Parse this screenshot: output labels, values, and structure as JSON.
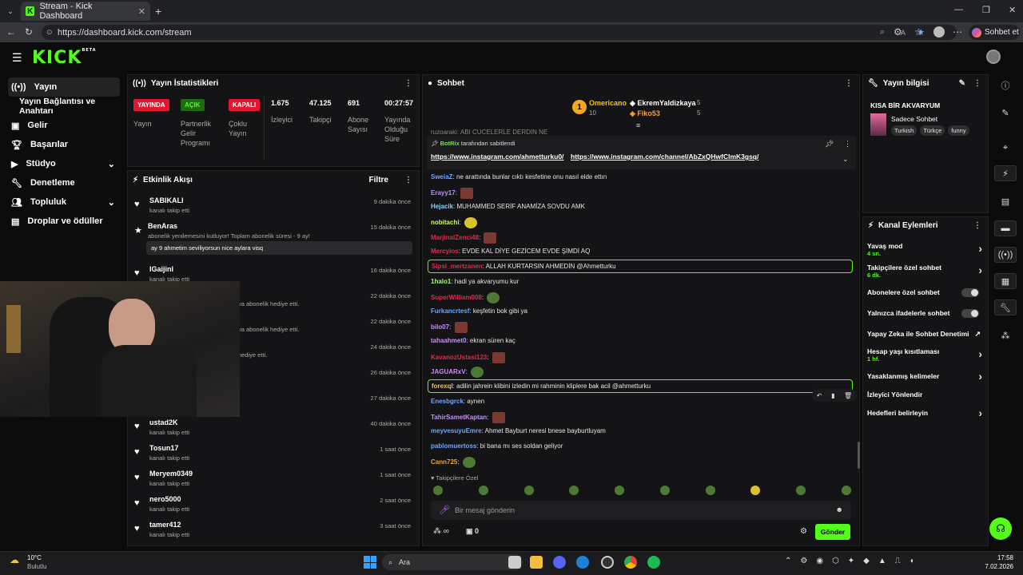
{
  "browser": {
    "tab_title": "Stream - Kick Dashboard",
    "url": "https://dashboard.kick.com/stream",
    "chat_button": "Sohbet et"
  },
  "logo": {
    "text": "KICK",
    "tag": "BETA"
  },
  "nav": {
    "items": [
      {
        "label": "Yayın",
        "icon": "broadcast-icon"
      },
      {
        "label": "Yayın Bağlantısı ve Anahtarı",
        "icon": ""
      },
      {
        "label": "Gelir",
        "icon": "dollar-icon"
      },
      {
        "label": "Başarılar",
        "icon": "trophy-icon"
      },
      {
        "label": "Stüdyo",
        "icon": "video-icon"
      },
      {
        "label": "Denetleme",
        "icon": "wrench-icon"
      },
      {
        "label": "Topluluk",
        "icon": "people-icon"
      },
      {
        "label": "Droplar ve ödüller",
        "icon": "gift-icon"
      }
    ]
  },
  "stats": {
    "title": "Yayın İstatistikleri",
    "badge_live": "YAYINDA",
    "badge_on": "AÇIK",
    "badge_off": "KAPALI",
    "label_live": "Yayın",
    "label_partner": "Partnerlik Gelir Programı",
    "label_multi": "Çoklu Yayın",
    "viewers": "1.675",
    "viewers_label": "İzleyici",
    "followers": "47.125",
    "followers_label": "Takipçi",
    "subs": "691",
    "subs_label": "Abone Sayısı",
    "uptime": "00:27:57",
    "uptime_label": "Yayında Olduğu Süre"
  },
  "activity": {
    "title": "Etkinlik Akışı",
    "filter": "Filtre",
    "items": [
      {
        "name": "SABIKALI",
        "sub": "kanalı takip etti",
        "time": "9 dakika önce"
      },
      {
        "name": "BenAras",
        "sub": "abonelik yenilemesini kutluyor! Toplam abonelik süresi - 9 ay!",
        "time": "15 dakika önce",
        "msg": "ay 9 ahmetim seviliyorsun nice aylara visq"
      },
      {
        "name": "IGaijinI",
        "sub": "kanalı takip etti",
        "time": "16 dakika önce"
      },
      {
        "name": "",
        "sub": "ya abonelik hediye etti.",
        "time": "22 dakika önce"
      },
      {
        "name": "",
        "sub": "ya abonelik hediye etti.",
        "time": "22 dakika önce"
      },
      {
        "name": "",
        "sub": "hediye etti.",
        "time": "24 dakika önce"
      },
      {
        "name": "",
        "sub": "",
        "time": "26 dakika önce"
      },
      {
        "name": "",
        "sub": "",
        "time": "27 dakika önce"
      },
      {
        "name": "ustad2K",
        "sub": "kanalı takip etti",
        "time": "40 dakika önce"
      },
      {
        "name": "Tosun17",
        "sub": "kanalı takip etti",
        "time": "1 saat önce"
      },
      {
        "name": "Meryem0349",
        "sub": "kanalı takip etti",
        "time": "1 saat önce"
      },
      {
        "name": "nero5000",
        "sub": "kanalı takip etti",
        "time": "2 saat önce"
      },
      {
        "name": "tamer412",
        "sub": "kanalı takip etti",
        "time": "3 saat önce"
      }
    ]
  },
  "chat": {
    "title": "Sohbet",
    "leader1": {
      "rank": "1",
      "name": "Omericano",
      "count": "10"
    },
    "leader2": {
      "name": "EkremYaldizkaya",
      "count": "5"
    },
    "leader3": {
      "name": "Fiko53",
      "count": "5"
    },
    "pinned_by": "BotRix",
    "pinned_suffix": "tarafından sabitlendi",
    "pinned_link1": "https://www.instagram.com/ahmetturku0/",
    "pinned_link2": "https://www.instagram.com/channel/AbZxQHwfCImK3gsq/",
    "cut_line": "ruzgaraki: ABI CUCELERLE DERDIN NE",
    "messages": [
      {
        "user": "SweiaZ",
        "color": "#6aa7ff",
        "text": "ne arattında bunlar cıktı kesfetine onu nasıl elde ettın"
      },
      {
        "user": "Erayy17",
        "color": "#c98cff",
        "text": "",
        "emote": "face"
      },
      {
        "user": "Hejacik",
        "color": "#7ed3ff",
        "text": "MUHAMMED SERİF ANAMİZA SOVDU AMK"
      },
      {
        "user": "nobitachi",
        "color": "#c7ff5a",
        "text": "",
        "emote": "yel"
      },
      {
        "user": "MarjinalZenci48",
        "color": "#d6304a",
        "text": "",
        "emote": "face"
      },
      {
        "user": "Mercylos",
        "color": "#d6304a",
        "text": "EVDE KAL DİYE GEZİCEM EVDE ŞİMDİ AQ"
      },
      {
        "user": "Sipsi_mertzanen",
        "color": "#d6304a",
        "text": "ALLAH KURTARSIN AHMEDİN @Ahmetturku",
        "highlight": true
      },
      {
        "user": "1halo1",
        "color": "#9dff6a",
        "text": "hadi ya akvaryumu kur"
      },
      {
        "user": "SuperWilliam008",
        "color": "#d6304a",
        "text": "",
        "emote": "frog"
      },
      {
        "user": "Furkancrtesf",
        "color": "#6aa7ff",
        "text": "keşfetin bok gibi ya"
      },
      {
        "user": "bilo07",
        "color": "#c98cff",
        "text": "",
        "emote": "face"
      },
      {
        "user": "tahaahmet0",
        "color": "#c98cff",
        "text": "ekran süren kaç"
      },
      {
        "user": "KavanozUstasi123",
        "color": "#d6304a",
        "text": "",
        "emote": "face"
      },
      {
        "user": "JAGUARxV",
        "color": "#c98cff",
        "text": "",
        "emote": "frog"
      },
      {
        "user": "forexql",
        "color": "#e8c35a",
        "text": "adilin jahrein klibini izledin mi rahminin kliplere bak acil @ahmetturku",
        "highlight": true
      },
      {
        "user": "Enesbgrck",
        "color": "#6aa7ff",
        "text": "aynen"
      },
      {
        "user": "TahirSametKaptan",
        "color": "#c98cff",
        "text": "",
        "emote": "face"
      },
      {
        "user": "meyvesuyuEmre",
        "color": "#6aa7ff",
        "text": "Ahmet Bayburt neresi bnese bayburtluyam"
      },
      {
        "user": "pablomuertoss",
        "color": "#6aa7ff",
        "text": "bi bana mı ses soldan geliyor"
      },
      {
        "user": "Cann725",
        "color": "#f0a040",
        "text": "",
        "emote": "frog"
      }
    ],
    "followers_only": "Takipçilere Özel",
    "input_placeholder": "Bir mesaj gönderin",
    "send": "Gönder",
    "points": "∞",
    "gifts": "0"
  },
  "info": {
    "title": "Yayın bilgisi",
    "stream_title": "KISA BİR AKVARYUM",
    "category": "Sadece Sohbet",
    "tags": [
      "Turkish",
      "Türkçe",
      "funny"
    ]
  },
  "actions": {
    "title": "Kanal Eylemleri",
    "items": [
      {
        "label": "Yavaş mod",
        "sub": "4 sn.",
        "type": "arrow"
      },
      {
        "label": "Takipçilere özel sohbet",
        "sub": "6 dk.",
        "type": "arrow"
      },
      {
        "label": "Abonelere özel sohbet",
        "sub": "",
        "type": "toggle"
      },
      {
        "label": "Yalnızca ifadelerle sohbet",
        "sub": "",
        "type": "toggle"
      },
      {
        "label": "Yapay Zeka ile Sohbet Denetimi",
        "sub": "",
        "type": "link"
      },
      {
        "label": "Hesap yaşı kısıtlaması",
        "sub": "1 hf.",
        "type": "arrow"
      },
      {
        "label": "Yasaklanmış kelimeler",
        "sub": "",
        "type": "arrow"
      },
      {
        "label": "İzleyici Yönlendir",
        "sub": "",
        "type": "none"
      },
      {
        "label": "Hedefleri belirleyin",
        "sub": "",
        "type": "arrow"
      }
    ]
  },
  "taskbar": {
    "temp": "10°C",
    "weather": "Bulutlu",
    "search": "Ara",
    "time": "17:58",
    "date": "7.02.2026"
  },
  "colors": {
    "accent": "#53fc18",
    "live": "#e3162f"
  }
}
